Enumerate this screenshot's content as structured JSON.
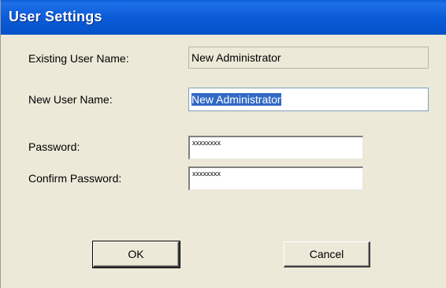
{
  "window": {
    "title": "User Settings"
  },
  "form": {
    "existing_user_label": "Existing User Name:",
    "existing_user_value": "New Administrator",
    "new_user_label": "New User Name:",
    "new_user_value": "New Administrator",
    "password_label": "Password:",
    "password_value": "xxxxxxxx",
    "confirm_password_label": "Confirm Password:",
    "confirm_password_value": "xxxxxxxx"
  },
  "buttons": {
    "ok_label": "OK",
    "cancel_label": "Cancel"
  },
  "colors": {
    "titlebar": "#0a5ad8",
    "dialog_bg": "#ece9d8",
    "selection": "#316ac5"
  }
}
